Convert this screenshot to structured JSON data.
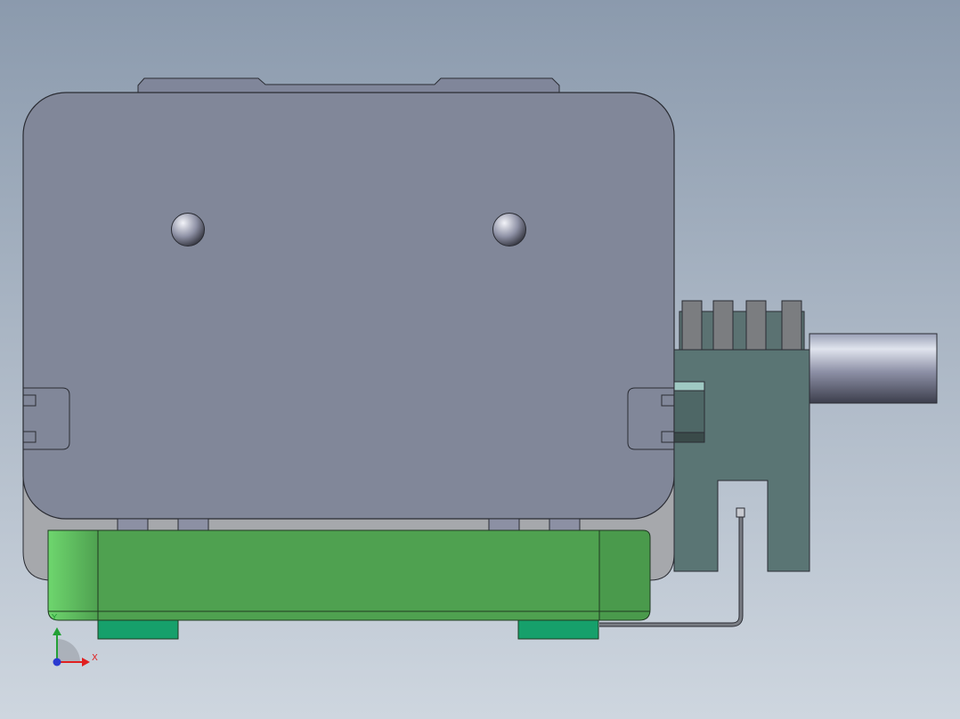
{
  "viewport": {
    "background_top": "#8b9aad",
    "background_bottom": "#ced6df"
  },
  "colors": {
    "housing": "#818799",
    "housing_stroke": "#2a2c33",
    "base_plate": "#a6a8ac",
    "green_block": "#4fa150",
    "green_highlight": "#66cc66",
    "green_foot": "#16a06b",
    "connector_block": "#5a7574",
    "connector_pin": "#7b7d80",
    "rod_light": "#e0e4ee",
    "rod_dark": "#3c3e4c",
    "cable": "#4c4f55"
  },
  "triad": {
    "y_label": "Y",
    "x_label": "X",
    "y_color": "#22a035",
    "x_color": "#e02020",
    "z_color": "#2a3ad0"
  },
  "icons": {
    "axis_triad": "axis-triad-icon"
  }
}
